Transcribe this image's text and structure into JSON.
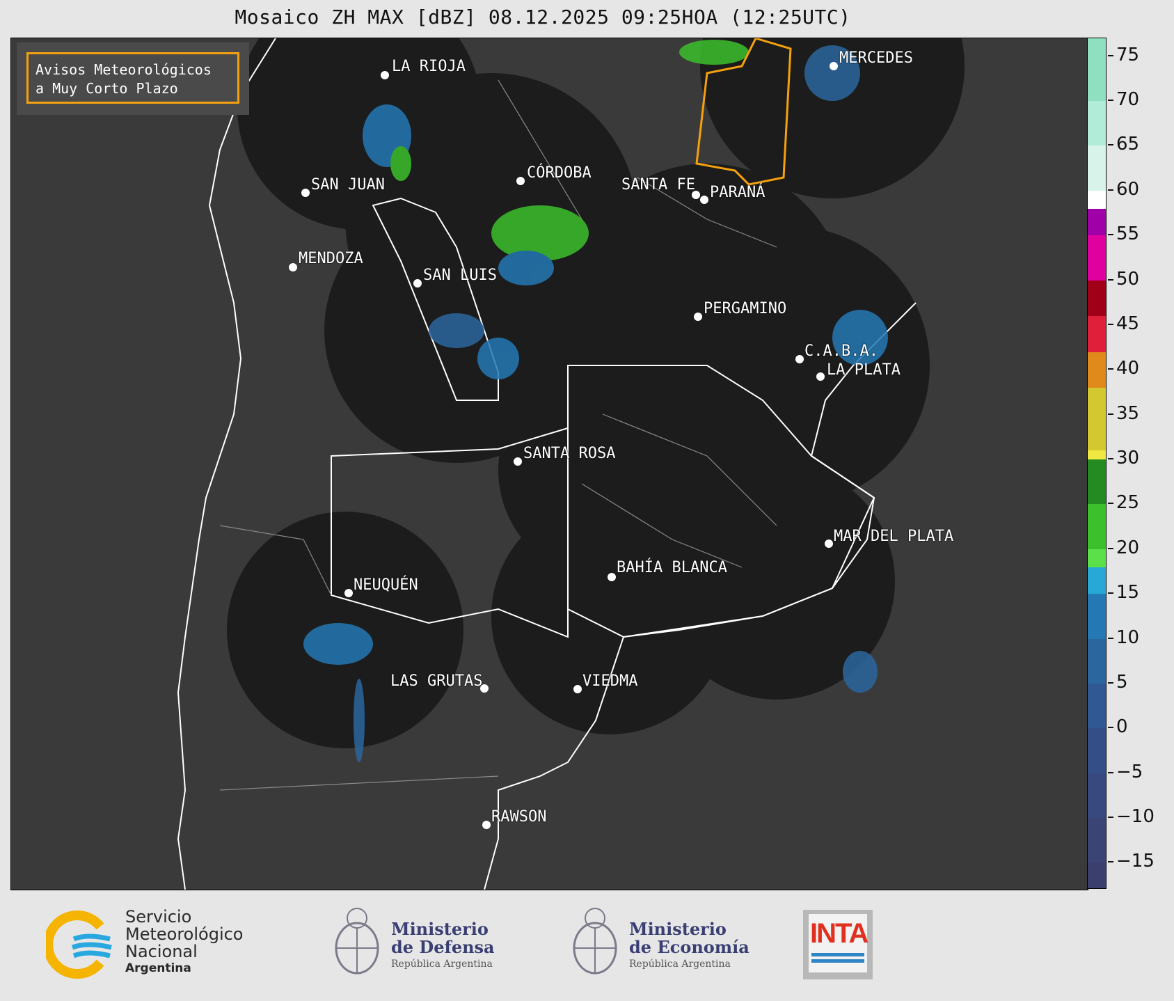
{
  "header": {
    "title": "Mosaico ZH MAX [dBZ] 08.12.2025 09:25HOA (12:25UTC)"
  },
  "notice": {
    "line1": "Avisos Meteorológicos",
    "line2": "a Muy Corto Plazo",
    "border_color": "#f5a10e"
  },
  "map": {
    "background_color": "#3a3a3a",
    "radar_coverage_color": "#1c1c1c",
    "cities": [
      {
        "name": "LA RIOJA"
      },
      {
        "name": "SAN JUAN"
      },
      {
        "name": "CÓRDOBA"
      },
      {
        "name": "SANTA FE"
      },
      {
        "name": "PARANÁ"
      },
      {
        "name": "MERCEDES"
      },
      {
        "name": "MENDOZA"
      },
      {
        "name": "SAN LUIS"
      },
      {
        "name": "PERGAMINO"
      },
      {
        "name": "C.A.B.A."
      },
      {
        "name": "LA PLATA"
      },
      {
        "name": "SANTA ROSA"
      },
      {
        "name": "MAR DEL PLATA"
      },
      {
        "name": "BAHÍA BLANCA"
      },
      {
        "name": "NEUQUÉN"
      },
      {
        "name": "LAS GRUTAS"
      },
      {
        "name": "VIEDMA"
      },
      {
        "name": "RAWSON"
      }
    ]
  },
  "colorbar": {
    "unit": "dBZ",
    "min": -18,
    "max": 77,
    "tick_labels": [
      "75",
      "70",
      "65",
      "60",
      "55",
      "50",
      "45",
      "40",
      "35",
      "30",
      "25",
      "20",
      "15",
      "10",
      "5",
      "0",
      "−5",
      "−10",
      "−15"
    ],
    "tick_values": [
      75,
      70,
      65,
      60,
      55,
      50,
      45,
      40,
      35,
      30,
      25,
      20,
      15,
      10,
      5,
      0,
      -5,
      -10,
      -15
    ],
    "bands": [
      {
        "from": -18,
        "to": -15,
        "color": "#3b3f6e"
      },
      {
        "from": -15,
        "to": -10,
        "color": "#3a4475"
      },
      {
        "from": -10,
        "to": -5,
        "color": "#37497f"
      },
      {
        "from": -5,
        "to": 0,
        "color": "#344f88"
      },
      {
        "from": 0,
        "to": 5,
        "color": "#305892"
      },
      {
        "from": 5,
        "to": 10,
        "color": "#2c669e"
      },
      {
        "from": 10,
        "to": 15,
        "color": "#2478b4"
      },
      {
        "from": 15,
        "to": 18,
        "color": "#27a8d6"
      },
      {
        "from": 18,
        "to": 20,
        "color": "#5ce04a"
      },
      {
        "from": 20,
        "to": 25,
        "color": "#3cc02c"
      },
      {
        "from": 25,
        "to": 30,
        "color": "#248a22"
      },
      {
        "from": 30,
        "to": 31,
        "color": "#f0e840"
      },
      {
        "from": 31,
        "to": 38,
        "color": "#d4c830"
      },
      {
        "from": 38,
        "to": 42,
        "color": "#e08a1c"
      },
      {
        "from": 42,
        "to": 46,
        "color": "#e0203a"
      },
      {
        "from": 46,
        "to": 50,
        "color": "#a00018"
      },
      {
        "from": 50,
        "to": 55,
        "color": "#e000a0"
      },
      {
        "from": 55,
        "to": 58,
        "color": "#a000a8"
      },
      {
        "from": 58,
        "to": 60,
        "color": "#ffffff"
      },
      {
        "from": 60,
        "to": 65,
        "color": "#d8f3ea"
      },
      {
        "from": 65,
        "to": 70,
        "color": "#b0ecd8"
      },
      {
        "from": 70,
        "to": 77,
        "color": "#8ee0c0"
      }
    ]
  },
  "logos": {
    "smn": {
      "line1": "Servicio",
      "line2": "Meteorológico",
      "line3": "Nacional",
      "line4": "Argentina"
    },
    "defensa": {
      "line1": "Ministerio",
      "line2": "de Defensa",
      "sub": "República Argentina"
    },
    "economia": {
      "line1": "Ministerio",
      "line2": "de Economía",
      "sub": "República Argentina"
    },
    "inta": {
      "text": "INTA"
    }
  }
}
